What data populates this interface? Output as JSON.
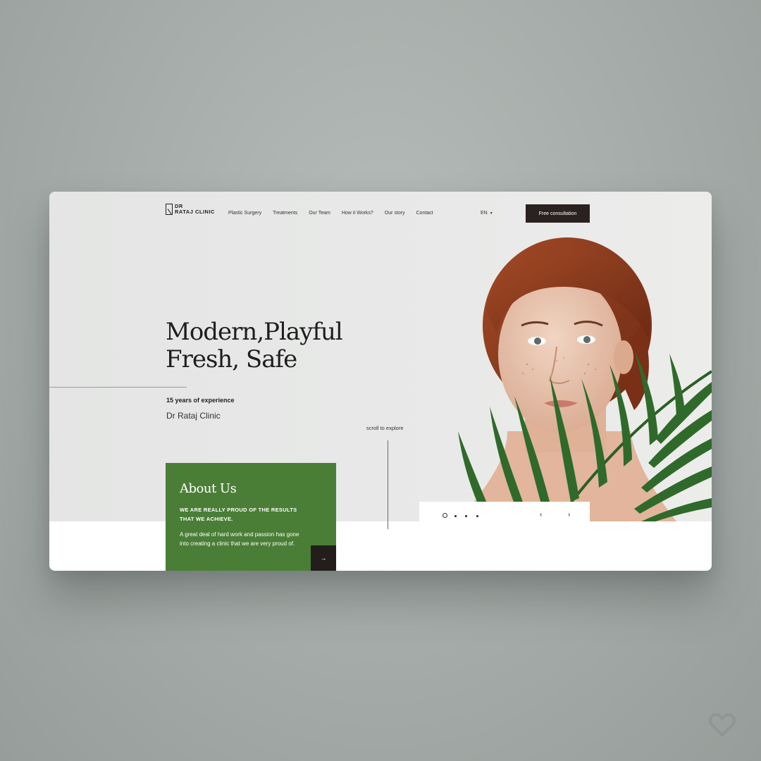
{
  "brand": {
    "logo_line1": "DR",
    "logo_line2": "RATAJ CLINIC"
  },
  "nav": {
    "items": [
      "Plastic Surgery",
      "Treatments",
      "Our Team",
      "How it Works?",
      "Our story",
      "Contact"
    ],
    "language": "EN",
    "cta_label": "Free consultation"
  },
  "hero": {
    "headline_line1": "Modern,Playful",
    "headline_line2": "Fresh, Safe",
    "years": "15 years of experience",
    "clinic_name": "Dr Rataj Clinic",
    "scroll_label": "scroll to explore"
  },
  "about": {
    "title": "About Us",
    "subtitle": "WE ARE REALLY PROUD OF THE RESULTS THAT WE ACHIEVE.",
    "body": "A great deal of hard work and passion has gone into creating a clinic that we are very proud of."
  },
  "slider": {
    "total_slides": 4,
    "active_index": 0
  },
  "colors": {
    "accent_green": "#4a7e37",
    "dark": "#2a2220",
    "leaf": "#2f6a2a",
    "hair": "#8b3a1f"
  },
  "icons": [
    "logo-icon",
    "caret-down-icon",
    "arrow-right-icon",
    "chevron-left-icon",
    "chevron-right-icon",
    "heart-icon"
  ]
}
